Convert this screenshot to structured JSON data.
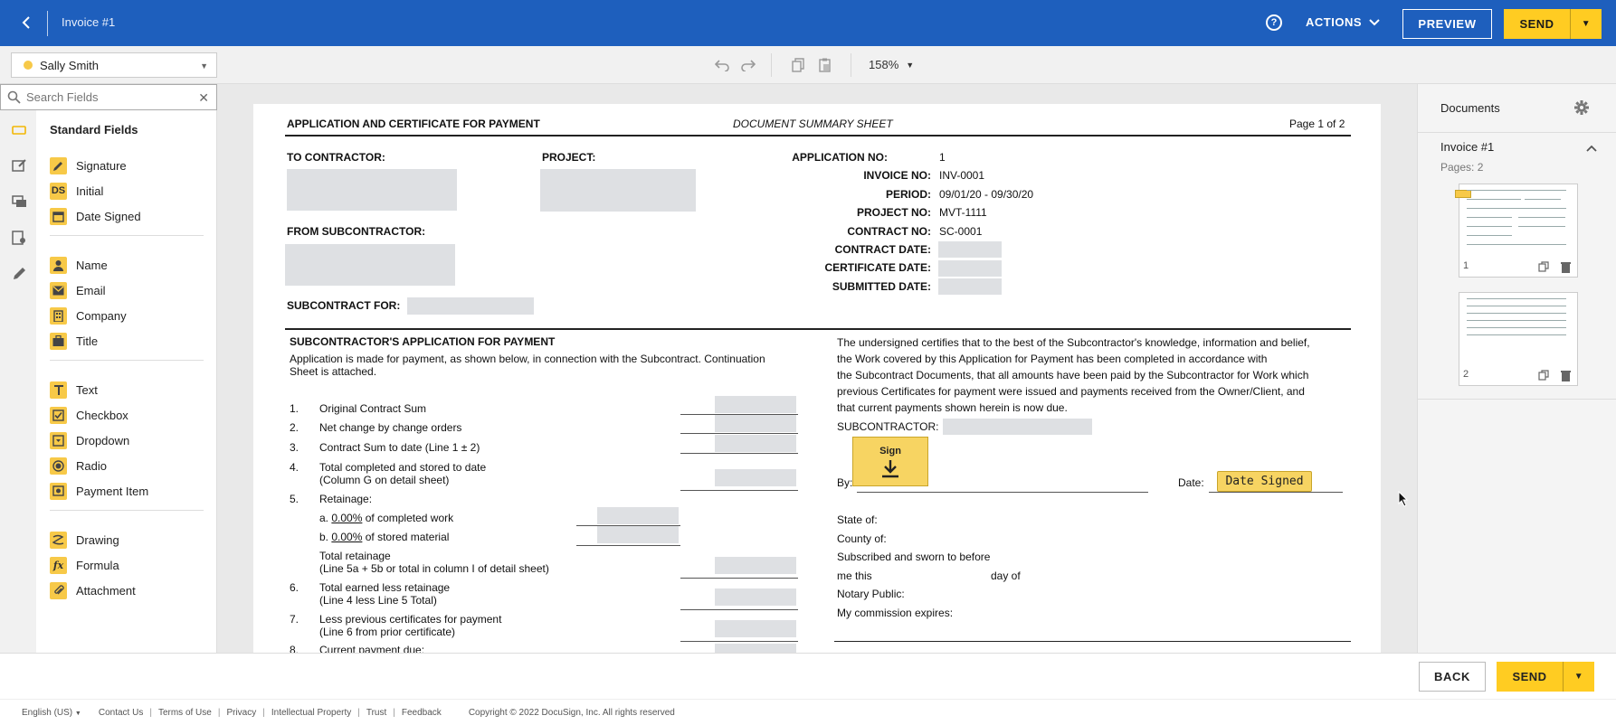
{
  "header": {
    "title": "Invoice #1",
    "actions_label": "ACTIONS",
    "preview_label": "PREVIEW",
    "send_label": "SEND"
  },
  "toolbar": {
    "recipient": "Sally Smith",
    "zoom": "158%"
  },
  "search": {
    "placeholder": "Search Fields"
  },
  "fields": {
    "heading": "Standard Fields",
    "group1": [
      "Signature",
      "Initial",
      "Date Signed"
    ],
    "group2": [
      "Name",
      "Email",
      "Company",
      "Title"
    ],
    "group3": [
      "Text",
      "Checkbox",
      "Dropdown",
      "Radio",
      "Payment Item"
    ],
    "group4": [
      "Drawing",
      "Formula",
      "Attachment"
    ],
    "initial_badge": "DS",
    "formula_badge": "fx"
  },
  "doc": {
    "title": "APPLICATION AND CERTIFICATE FOR PAYMENT",
    "subtitle": "DOCUMENT SUMMARY SHEET",
    "page": "Page 1 of 2",
    "to_contractor": "TO CONTRACTOR:",
    "project": "PROJECT:",
    "from_sub": "FROM SUBCONTRACTOR:",
    "sub_for": "SUBCONTRACT FOR:",
    "info": [
      {
        "label": "APPLICATION NO:",
        "value": "1"
      },
      {
        "label": "INVOICE NO:",
        "value": "INV-0001"
      },
      {
        "label": "PERIOD:",
        "value": "09/01/20 - 09/30/20"
      },
      {
        "label": "PROJECT NO:",
        "value": "MVT-1111"
      },
      {
        "label": "CONTRACT NO:",
        "value": "SC-0001"
      },
      {
        "label": "CONTRACT DATE:",
        "value": ""
      },
      {
        "label": "CERTIFICATE DATE:",
        "value": ""
      },
      {
        "label": "SUBMITTED DATE:",
        "value": ""
      }
    ],
    "app_heading": "SUBCONTRACTOR'S APPLICATION FOR PAYMENT",
    "app_intro1": "Application is made for payment, as shown below, in connection with the Subcontract. Continuation",
    "app_intro2": "Sheet is attached.",
    "lines": {
      "l1n": "1.",
      "l1": "Original Contract Sum",
      "l2n": "2.",
      "l2": "Net change by change orders",
      "l3n": "3.",
      "l3": "Contract Sum to date (Line 1 ± 2)",
      "l4n": "4.",
      "l4a": "Total completed and stored to date",
      "l4b": "(Column G on detail sheet)",
      "l5n": "5.",
      "l5": "Retainage:",
      "l5a_pre": "a.",
      "l5a_pct": "0.00%",
      "l5a_post": "of completed work",
      "l5b_pre": "b.",
      "l5b_pct": "0.00%",
      "l5b_post": "of stored material",
      "tr_a": "Total retainage",
      "tr_b": "(Line 5a + 5b or total in column I of detail sheet)",
      "l6n": "6.",
      "l6a": "Total earned less retainage",
      "l6b": "(Line 4 less Line 5 Total)",
      "l7n": "7.",
      "l7a": "Less previous certificates for payment",
      "l7b": "(Line 6 from prior certificate)",
      "l8n": "8.",
      "l8": "Current payment due:"
    },
    "cert": [
      "The undersigned certifies that to the best of the Subcontractor's knowledge, information and belief,",
      "the Work covered by this Application for Payment has been completed in accordance with",
      "the Subcontract Documents, that all amounts have been paid by the Subcontractor for Work which",
      "previous Certificates for payment were issued and payments received from the Owner/Client, and",
      "that current payments shown herein is now due."
    ],
    "subcontractor": "SUBCONTRACTOR:",
    "by": "By:",
    "date": "Date:",
    "notary": {
      "state": "State of:",
      "county": "County of:",
      "sworn": "Subscribed and sworn to before",
      "me_this": "me this",
      "day_of": "day of",
      "public": "Notary Public:",
      "expires": "My commission expires:"
    },
    "sign_tag": "Sign",
    "date_tag": "Date Signed"
  },
  "documents": {
    "title": "Documents",
    "name": "Invoice #1",
    "pages": "Pages: 2",
    "thumbs": [
      "1",
      "2"
    ]
  },
  "bottom": {
    "back": "BACK",
    "send": "SEND"
  },
  "footer": {
    "language": "English (US)",
    "links": [
      "Contact Us",
      "Terms of Use",
      "Privacy",
      "Intellectual Property",
      "Trust",
      "Feedback"
    ],
    "copyright": "Copyright © 2022 DocuSign, Inc. All rights reserved"
  },
  "colors": {
    "brand_blue": "#1e5fbd",
    "accent_yellow": "#ffcc22",
    "tag_yellow": "#f7d462"
  }
}
